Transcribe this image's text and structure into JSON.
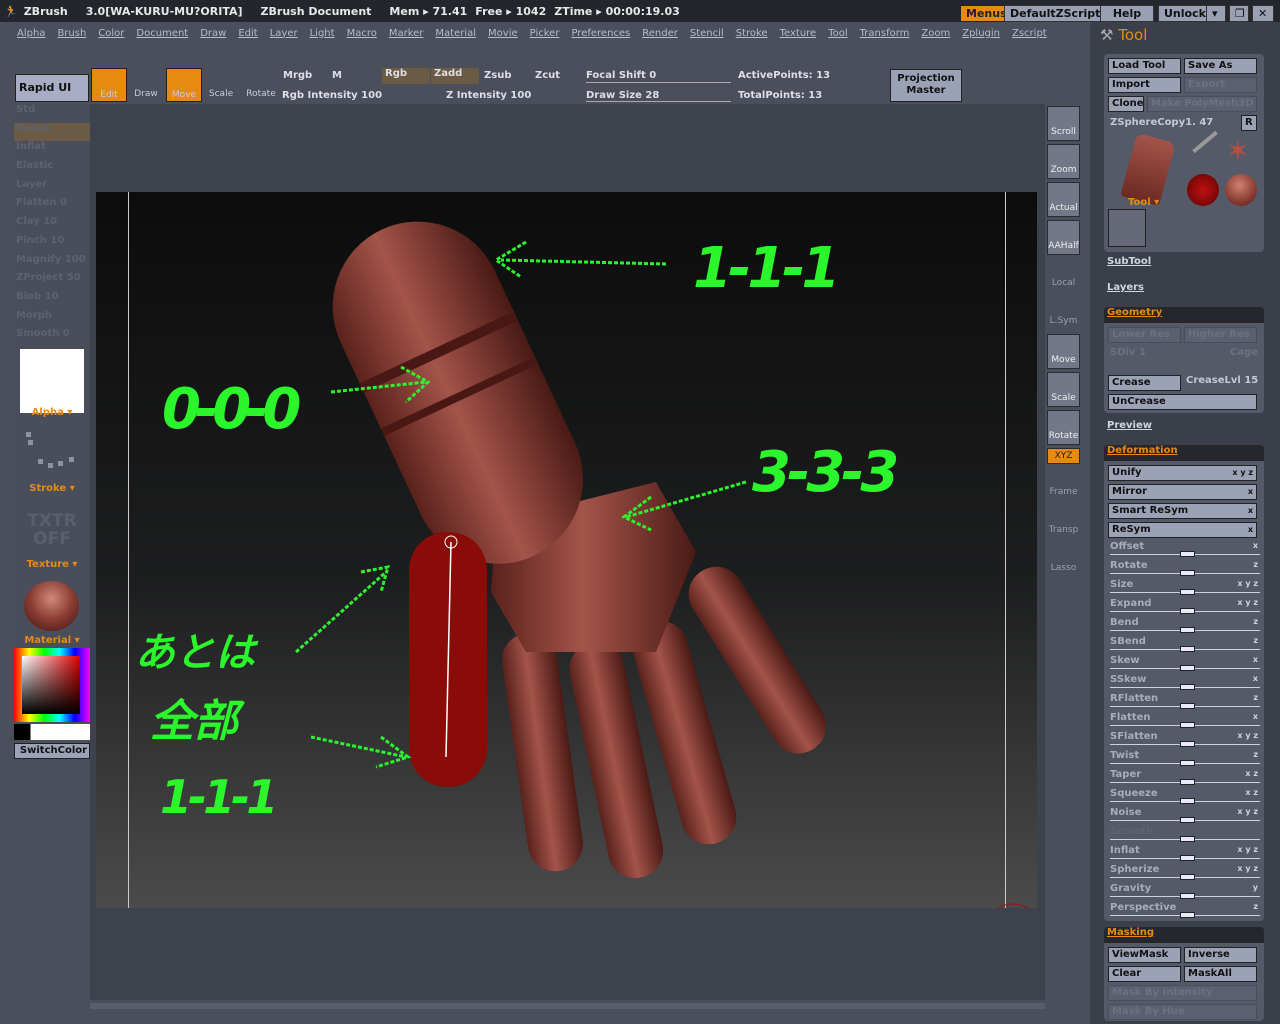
{
  "titlebar": {
    "app": "ZBrush",
    "version": "3.0[WA-KURU-MU?ORITA]",
    "doc": "ZBrush Document",
    "mem": "Mem ▸ 71.41",
    "free": "Free ▸ 1042",
    "ztime": "ZTime ▸ 00:00:19.03",
    "buttons": [
      "Menus",
      "DefaultZScript",
      "Help",
      "Unlock"
    ]
  },
  "menus": [
    "Alpha",
    "Brush",
    "Color",
    "Document",
    "Draw",
    "Edit",
    "Layer",
    "Light",
    "Macro",
    "Marker",
    "Material",
    "Movie",
    "Picker",
    "Preferences",
    "Render",
    "Stencil",
    "Stroke",
    "Texture",
    "Tool",
    "Transform",
    "Zoom",
    "Zplugin",
    "Zscript"
  ],
  "toolbar": {
    "rapid_ui": "Rapid UI",
    "edit": "Edit",
    "draw": "Draw",
    "move": "Move",
    "scale": "Scale",
    "rotate": "Rotate",
    "mrgb": "Mrgb",
    "m": "M",
    "rgb": "Rgb",
    "zadd": "Zadd",
    "zsub": "Zsub",
    "zcut": "Zcut",
    "rgb_intensity": "Rgb  Intensity 100",
    "z_intensity": "Z Intensity 100",
    "focal_shift": "Focal  Shift 0",
    "draw_size": "Draw  Size 28",
    "active_points": "ActivePoints: 13",
    "total_points": "TotalPoints: 13",
    "projection_master": "Projection Master"
  },
  "left_shelf": {
    "brushes": [
      "Std",
      "Tweak",
      "Inflat",
      "Elastic",
      "Layer",
      "Flatten 0",
      "Clay 10",
      "Pinch 10",
      "Magnify 100",
      "ZProject 50",
      "Blob 10",
      "Morph",
      "Smooth 0"
    ],
    "alpha": "Alpha",
    "stroke": "Stroke",
    "texture_off": "TXTR OFF",
    "texture": "Texture",
    "material": "Material",
    "switch_color": "SwitchColor"
  },
  "right_toolbar": [
    "Scroll",
    "Zoom",
    "Actual",
    "AAHalf",
    "Local",
    "L.Sym",
    "Move",
    "Scale",
    "Rotate",
    "XYZ",
    "Frame",
    "Transp",
    "Lasso"
  ],
  "tool_panel": {
    "title": "Tool",
    "load_tool": "Load Tool",
    "save_as": "Save As",
    "import": "Import",
    "export": "Export",
    "clone": "Clone",
    "make_polymesh": "Make PolyMesh3D",
    "tool_name": "ZSphereCopy1. 47",
    "r": "R",
    "tool_label": "Tool",
    "subtool": "SubTool",
    "layers": "Layers",
    "geometry": {
      "title": "Geometry",
      "lower_res": "Lower Res",
      "higher_res": "Higher Res",
      "sdiv": "SDiv 1",
      "cage": "Cage",
      "crease": "Crease",
      "crease_lvl": "CreaseLvl 15",
      "uncrease": "UnCrease"
    },
    "preview": "Preview",
    "deformation": {
      "title": "Deformation",
      "buttons": [
        {
          "label": "Unify",
          "axes": "x y z"
        },
        {
          "label": "Mirror",
          "axes": "x"
        },
        {
          "label": "Smart ReSym",
          "axes": "x"
        },
        {
          "label": "ReSym",
          "axes": "x"
        }
      ],
      "sliders": [
        {
          "label": "Offset",
          "axes": "x"
        },
        {
          "label": "Rotate",
          "axes": "z"
        },
        {
          "label": "Size",
          "axes": "x y z"
        },
        {
          "label": "Expand",
          "axes": "x y z"
        },
        {
          "label": "Bend",
          "axes": "z"
        },
        {
          "label": "SBend",
          "axes": "z"
        },
        {
          "label": "Skew",
          "axes": "x"
        },
        {
          "label": "SSkew",
          "axes": "x"
        },
        {
          "label": "RFlatten",
          "axes": "z"
        },
        {
          "label": "Flatten",
          "axes": "x"
        },
        {
          "label": "SFlatten",
          "axes": "x y z"
        },
        {
          "label": "Twist",
          "axes": "z"
        },
        {
          "label": "Taper",
          "axes": "x  z"
        },
        {
          "label": "Squeeze",
          "axes": "x  z"
        },
        {
          "label": "Noise",
          "axes": "x y z"
        },
        {
          "label": "Smooth",
          "axes": ""
        },
        {
          "label": "Inflat",
          "axes": "x y z"
        },
        {
          "label": "Spherize",
          "axes": "x y z"
        },
        {
          "label": "Gravity",
          "axes": "y"
        },
        {
          "label": "Perspective",
          "axes": "z"
        }
      ]
    },
    "masking": {
      "title": "Masking",
      "viewmask": "ViewMask",
      "inverse": "Inverse",
      "clear": "Clear",
      "maskall": "MaskAll",
      "by_intensity": "Mask By Intensity",
      "by_hue": "Mask By Hue"
    }
  },
  "annotations": {
    "top": "1-1-1",
    "middle": "0-0-0",
    "palm": "3-3-3",
    "rest_line1": "あとは",
    "rest_line2": "全部",
    "rest_line3": "1-1-1"
  },
  "colors": {
    "accent": "#e88a12",
    "annotation": "#2bf52b",
    "model": "#8a3c33"
  }
}
